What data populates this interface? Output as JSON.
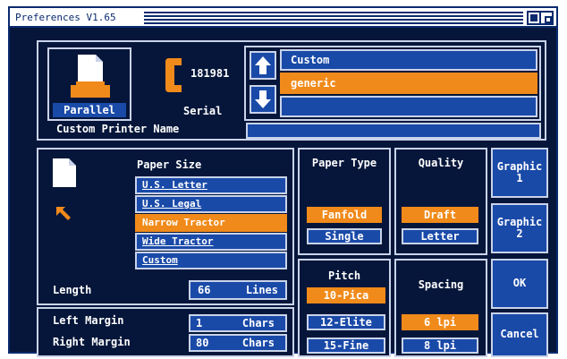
{
  "window": {
    "title": "Preferences V1.65"
  },
  "port": {
    "parallel_label": "Parallel",
    "serial_label": "Serial",
    "serial_number": "181981",
    "custom_name_label": "Custom Printer Name",
    "custom_name_value": "",
    "selected": "Parallel"
  },
  "printer_list": {
    "items": [
      "Custom",
      "generic",
      ""
    ],
    "selected": "generic"
  },
  "paper_size": {
    "title": "Paper Size",
    "items": [
      "U.S. Letter",
      "U.S. Legal",
      "Narrow Tractor",
      "Wide Tractor",
      "Custom"
    ],
    "selected": "Narrow Tractor",
    "length_label": "Length",
    "length_value": "66",
    "length_unit": "Lines"
  },
  "margins": {
    "left_label": "Left Margin",
    "left_value": "1",
    "left_unit": "Chars",
    "right_label": "Right Margin",
    "right_value": "80",
    "right_unit": "Chars"
  },
  "paper_type": {
    "title": "Paper Type",
    "options": [
      "Fanfold",
      "Single"
    ],
    "selected": "Fanfold"
  },
  "quality": {
    "title": "Quality",
    "options": [
      "Draft",
      "Letter"
    ],
    "selected": "Draft"
  },
  "pitch": {
    "title": "Pitch",
    "options": [
      "10-Pica",
      "12-Elite",
      "15-Fine"
    ],
    "selected": "10-Pica"
  },
  "spacing": {
    "title": "Spacing",
    "options": [
      "6 lpi",
      "8 lpi"
    ],
    "selected": "6 lpi"
  },
  "buttons": {
    "graphic1": "Graphic 1",
    "graphic2": "Graphic 2",
    "ok": "OK",
    "cancel": "Cancel"
  },
  "colors": {
    "background": "#05163a",
    "panel_fill": "#1a4aa8",
    "border": "#c9d3ea",
    "selected": "#f08a1a"
  },
  "icons": [
    "printer-icon",
    "phone-icon",
    "paper-icon",
    "arrow-up-icon",
    "arrow-down-icon",
    "close-icon",
    "depth-icon"
  ]
}
